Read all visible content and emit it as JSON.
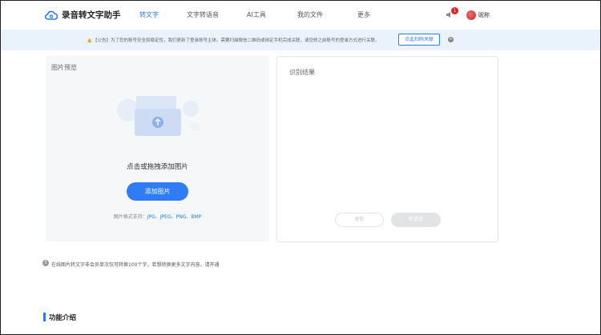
{
  "header": {
    "app_name": "录音转文字助手",
    "nav": [
      "转文字",
      "文字转语音",
      "AI工具",
      "我的文件",
      "更多"
    ],
    "notification_count": "1",
    "user_name": "昵称"
  },
  "notice": {
    "text": "【公告】为了您的账号安全和稳定性，我们更新了登录账号主体。需要扫描微信二维码或绑定手机完成关联，请您修之前账号的登录方式进行关联。",
    "button_label": "点此扫码关联",
    "close_icon": "×"
  },
  "preview": {
    "title": "图片预览",
    "upload_hint": "点击或拖拽添加图片",
    "add_button": "添加图片",
    "formats_label": "图片格式支持：",
    "formats": "JPG、JPEG、PNG、BMP"
  },
  "result": {
    "title": "识别结果",
    "copy_button": "复制",
    "convert_button": "转语音"
  },
  "tip": {
    "icon": "!",
    "text": "在线图片转文字非会员单次仅可转换100个字，若想转换更多文字内容，请开通"
  },
  "section": {
    "title": "功能介绍"
  },
  "colors": {
    "accent": "#2f7cf6",
    "notice_bg": "#eaf3fc",
    "badge": "#e02020"
  }
}
